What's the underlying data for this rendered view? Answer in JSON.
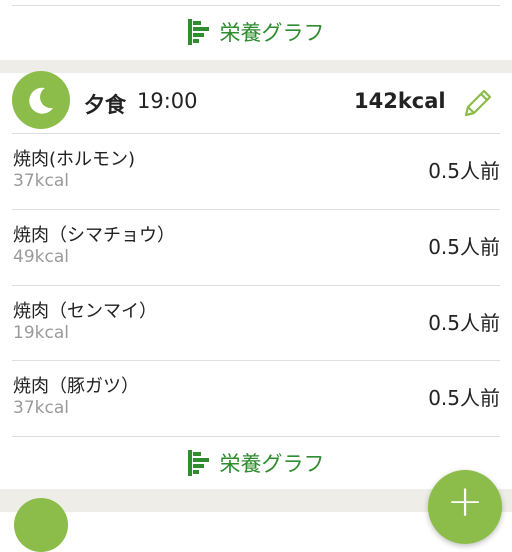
{
  "graph_link_label": "栄養グラフ",
  "meal": {
    "name": "夕食",
    "time": "19:00",
    "kcal": "142kcal",
    "icon": "moon-icon",
    "items": [
      {
        "name": "焼肉(ホルモン)",
        "kcal": "37kcal",
        "qty": "0.5人前"
      },
      {
        "name": "焼肉（シマチョウ）",
        "kcal": "49kcal",
        "qty": "0.5人前"
      },
      {
        "name": "焼肉（センマイ）",
        "kcal": "19kcal",
        "qty": "0.5人前"
      },
      {
        "name": "焼肉（豚ガツ）",
        "kcal": "37kcal",
        "qty": "0.5人前"
      }
    ]
  },
  "fab_label": "+",
  "colors": {
    "accent_green": "#8cbd4a",
    "link_green": "#2f8c2f",
    "gap_beige": "#efede7"
  }
}
